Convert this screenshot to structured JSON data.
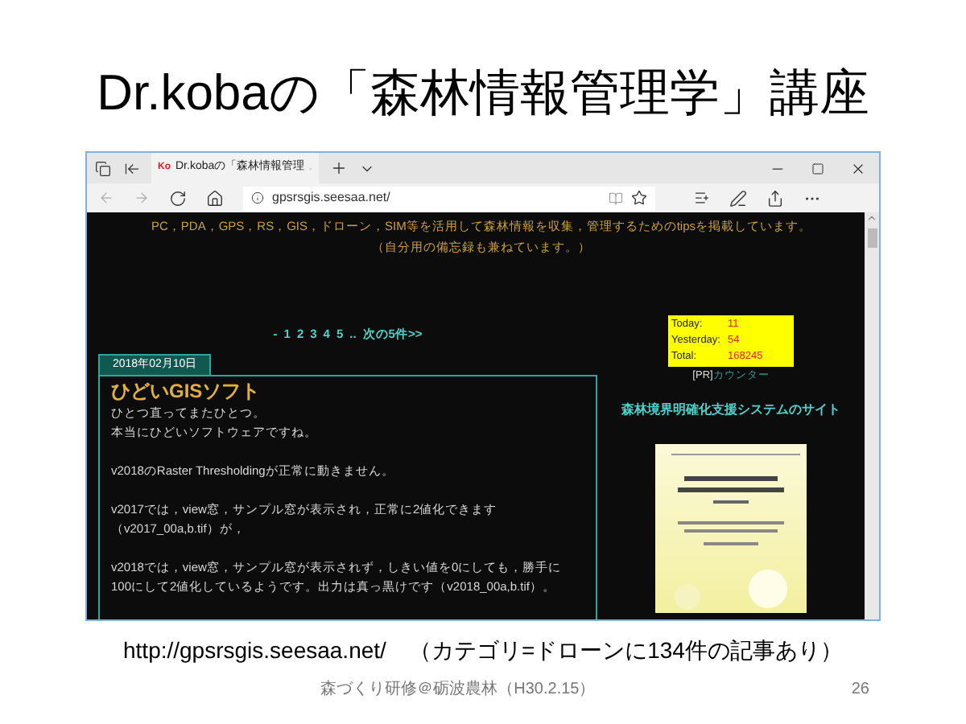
{
  "slide_title": "Dr.kobaの「森林情報管理学」講座",
  "browser": {
    "tab": {
      "favicon": "Ko",
      "title": "Dr.kobaの「森林情報管理",
      "selected": true
    },
    "address": "gpsrsgis.seesaa.net/",
    "page": {
      "header_lines": [
        "PC，PDA，GPS，RS，GIS，ドローン，SIM等を活用して森林情報を収集，管理するためのtipsを掲載しています。",
        "（自分用の備忘録も兼ねています。）"
      ],
      "pager": {
        "lead": "-",
        "pages": [
          "1",
          "2",
          "3",
          "4",
          "5"
        ],
        "more": "..",
        "next": "次の5件>>"
      },
      "post": {
        "date": "2018年02月10日",
        "title": "ひどいGISソフト",
        "paragraphs": [
          [
            "ひとつ直ってまたひとつ。",
            "本当にひどいソフトウェアですね。"
          ],
          [
            "v2018のRaster Thresholdingが正常に動きません。"
          ],
          [
            "v2017では，view窓，サンプル窓が表示され，正常に2値化できます",
            "（v2017_00a,b.tif）が，"
          ],
          [
            "v2018では，view窓，サンプル窓が表示されず，しきい値を0にしても，勝手に",
            "100にして2値化しているようです。出力は真っ黒けです（v2018_00a,b.tif）。"
          ]
        ]
      },
      "counter": {
        "rows": [
          {
            "label": "Today:",
            "value": "11"
          },
          {
            "label": "Yesterday:",
            "value": "54"
          },
          {
            "label": "Total:",
            "value": "168245"
          }
        ],
        "pr": "[PR]",
        "link": "カウンター"
      },
      "side_heading": "森林境界明確化支援システムのサイト",
      "cover": {
        "kind": "picture"
      }
    }
  },
  "caption": {
    "url": "http://gpsrsgis.seesaa.net/",
    "note": "（カテゴリ=ドローンに134件の記事あり）"
  },
  "footer": {
    "text": "森づくり研修＠砺波農林（H30.2.15）",
    "page": "26"
  }
}
